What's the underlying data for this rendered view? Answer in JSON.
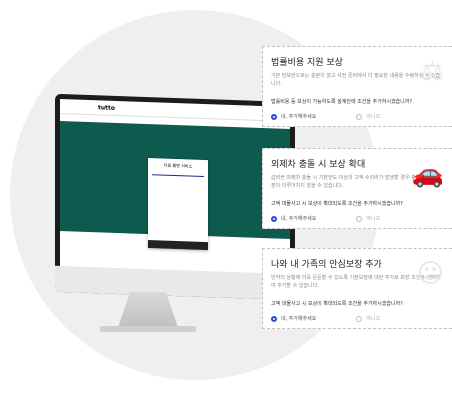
{
  "screen": {
    "logo": "tutto",
    "nav_links": [
      "",
      "",
      "",
      ""
    ],
    "steps": [
      "",
      "",
      ""
    ],
    "side_lines": [
      "",
      ""
    ],
    "modal_title": "다음 플랜 서비스",
    "modal_button": "",
    "accent": "#0d5a4e"
  },
  "cards": [
    {
      "title": "법률비용 지원 보상",
      "description": "기본 담보만으로는 충분치 않고 사전 준비에서 더 필요한 내용을 수령하실 수 있습니다.",
      "question": "법률비용 등 보상이 가능하도록 설계안에 조건을 추가하시겠습니까?",
      "option_yes": "네, 추가해주세요",
      "option_no": "아니오",
      "icon": "scales-icon"
    },
    {
      "title": "외제차 충돌 시 보상 확대",
      "description": "값비싼 외제차 충돌 시 기본한도 이상의 고액 수리비가 발생할 경우 충분한 보험 보장이 이루어지지 않을 수 있습니다.",
      "question": "고액 대물사고 시 보상이 확대되도록 조건을 추가하시겠습니까?",
      "option_yes": "네, 추가해주세요",
      "option_no": "아니오",
      "icon": "car-icon"
    },
    {
      "title": "나와 내 가족의 안심보장 추가",
      "description": "만약의 상황에 더욱 든든할 수 있도록 기본보장에 대한 추가로 보장 조건을 선택하여 추가할 수 있습니다.",
      "question": "고액 대물사고 시 보상이 확대되도록 조건을 추가하시겠습니까?",
      "option_yes": "네, 추가해주세요",
      "option_no": "아니오",
      "icon": "family-icon"
    }
  ]
}
